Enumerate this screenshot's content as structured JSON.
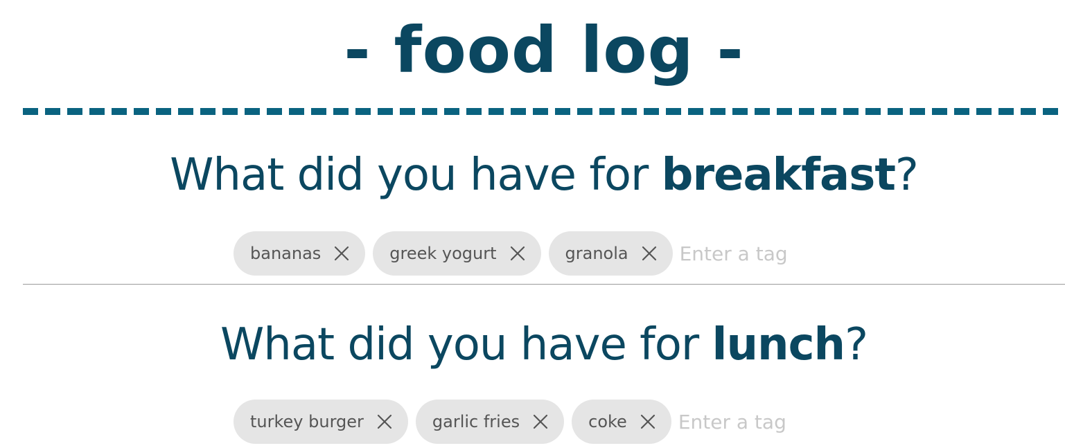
{
  "app": {
    "title": "- food log -",
    "colors": {
      "primary": "#0b4760",
      "rule": "#0a6380",
      "chip_bg": "#e5e5e5",
      "chip_text": "#555555",
      "placeholder": "#c8c8c8"
    }
  },
  "meals": [
    {
      "question_prefix": "What did you have for ",
      "meal_name": "breakfast",
      "question_suffix": "?",
      "tags": [
        "bananas",
        "greek yogurt",
        "granola"
      ],
      "input_placeholder": "Enter a tag",
      "input_value": ""
    },
    {
      "question_prefix": "What did you have for ",
      "meal_name": "lunch",
      "question_suffix": "?",
      "tags": [
        "turkey burger",
        "garlic fries",
        "coke"
      ],
      "input_placeholder": "Enter a tag",
      "input_value": ""
    }
  ],
  "icons": {
    "tag_remove": "close-icon"
  }
}
